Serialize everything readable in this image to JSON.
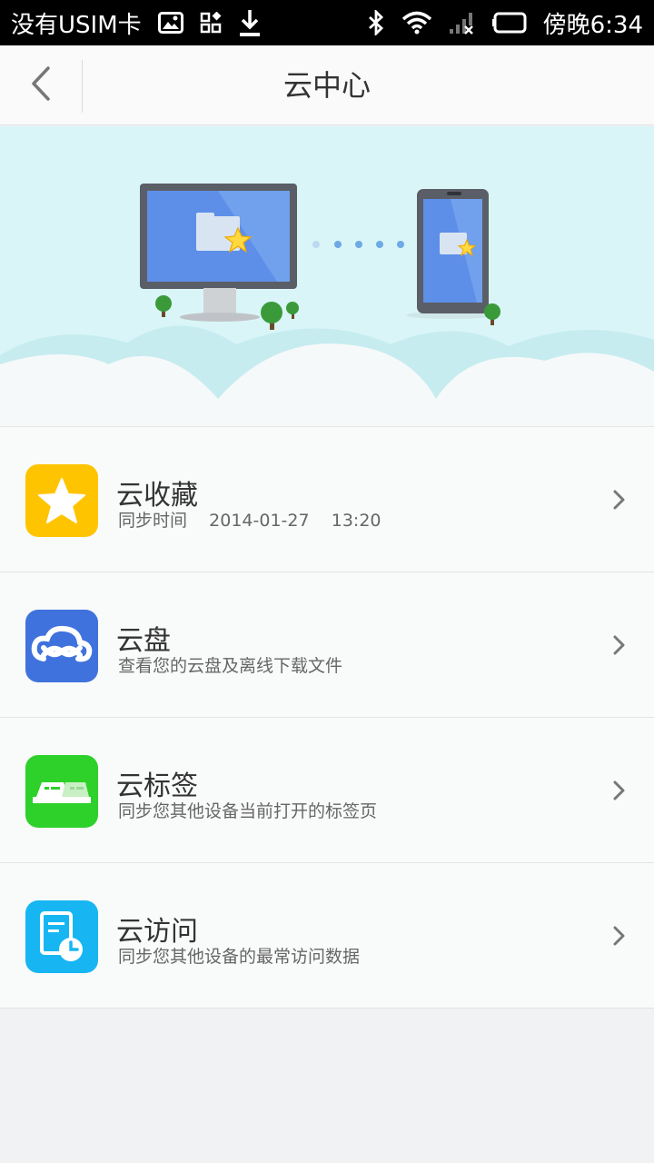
{
  "status_bar": {
    "carrier": "没有USIM卡",
    "time": "傍晚6:34",
    "icons": [
      "image-icon",
      "grid-icon",
      "download-icon",
      "bluetooth-icon",
      "wifi-icon",
      "signal-icon",
      "battery-icon"
    ]
  },
  "header": {
    "title": "云中心",
    "back_icon": "chevron-left-icon"
  },
  "hero": {
    "illustration": "monitor-to-phone-sync"
  },
  "items": [
    {
      "title": "云收藏",
      "subtitle": "同步时间    2014-01-27    13:20",
      "icon": "star-icon",
      "color": "#ffc400"
    },
    {
      "title": "云盘",
      "subtitle": "查看您的云盘及离线下载文件",
      "icon": "cloud-drive-icon",
      "color": "#3f72dd"
    },
    {
      "title": "云标签",
      "subtitle": "同步您其他设备当前打开的标签页",
      "icon": "tabs-icon",
      "color": "#2ed02a"
    },
    {
      "title": "云访问",
      "subtitle": "同步您其他设备的最常访问数据",
      "icon": "history-icon",
      "color": "#17b6f2"
    }
  ],
  "colors": {
    "hero_bg": "#d9f5f7",
    "status_bar": "#000000"
  }
}
